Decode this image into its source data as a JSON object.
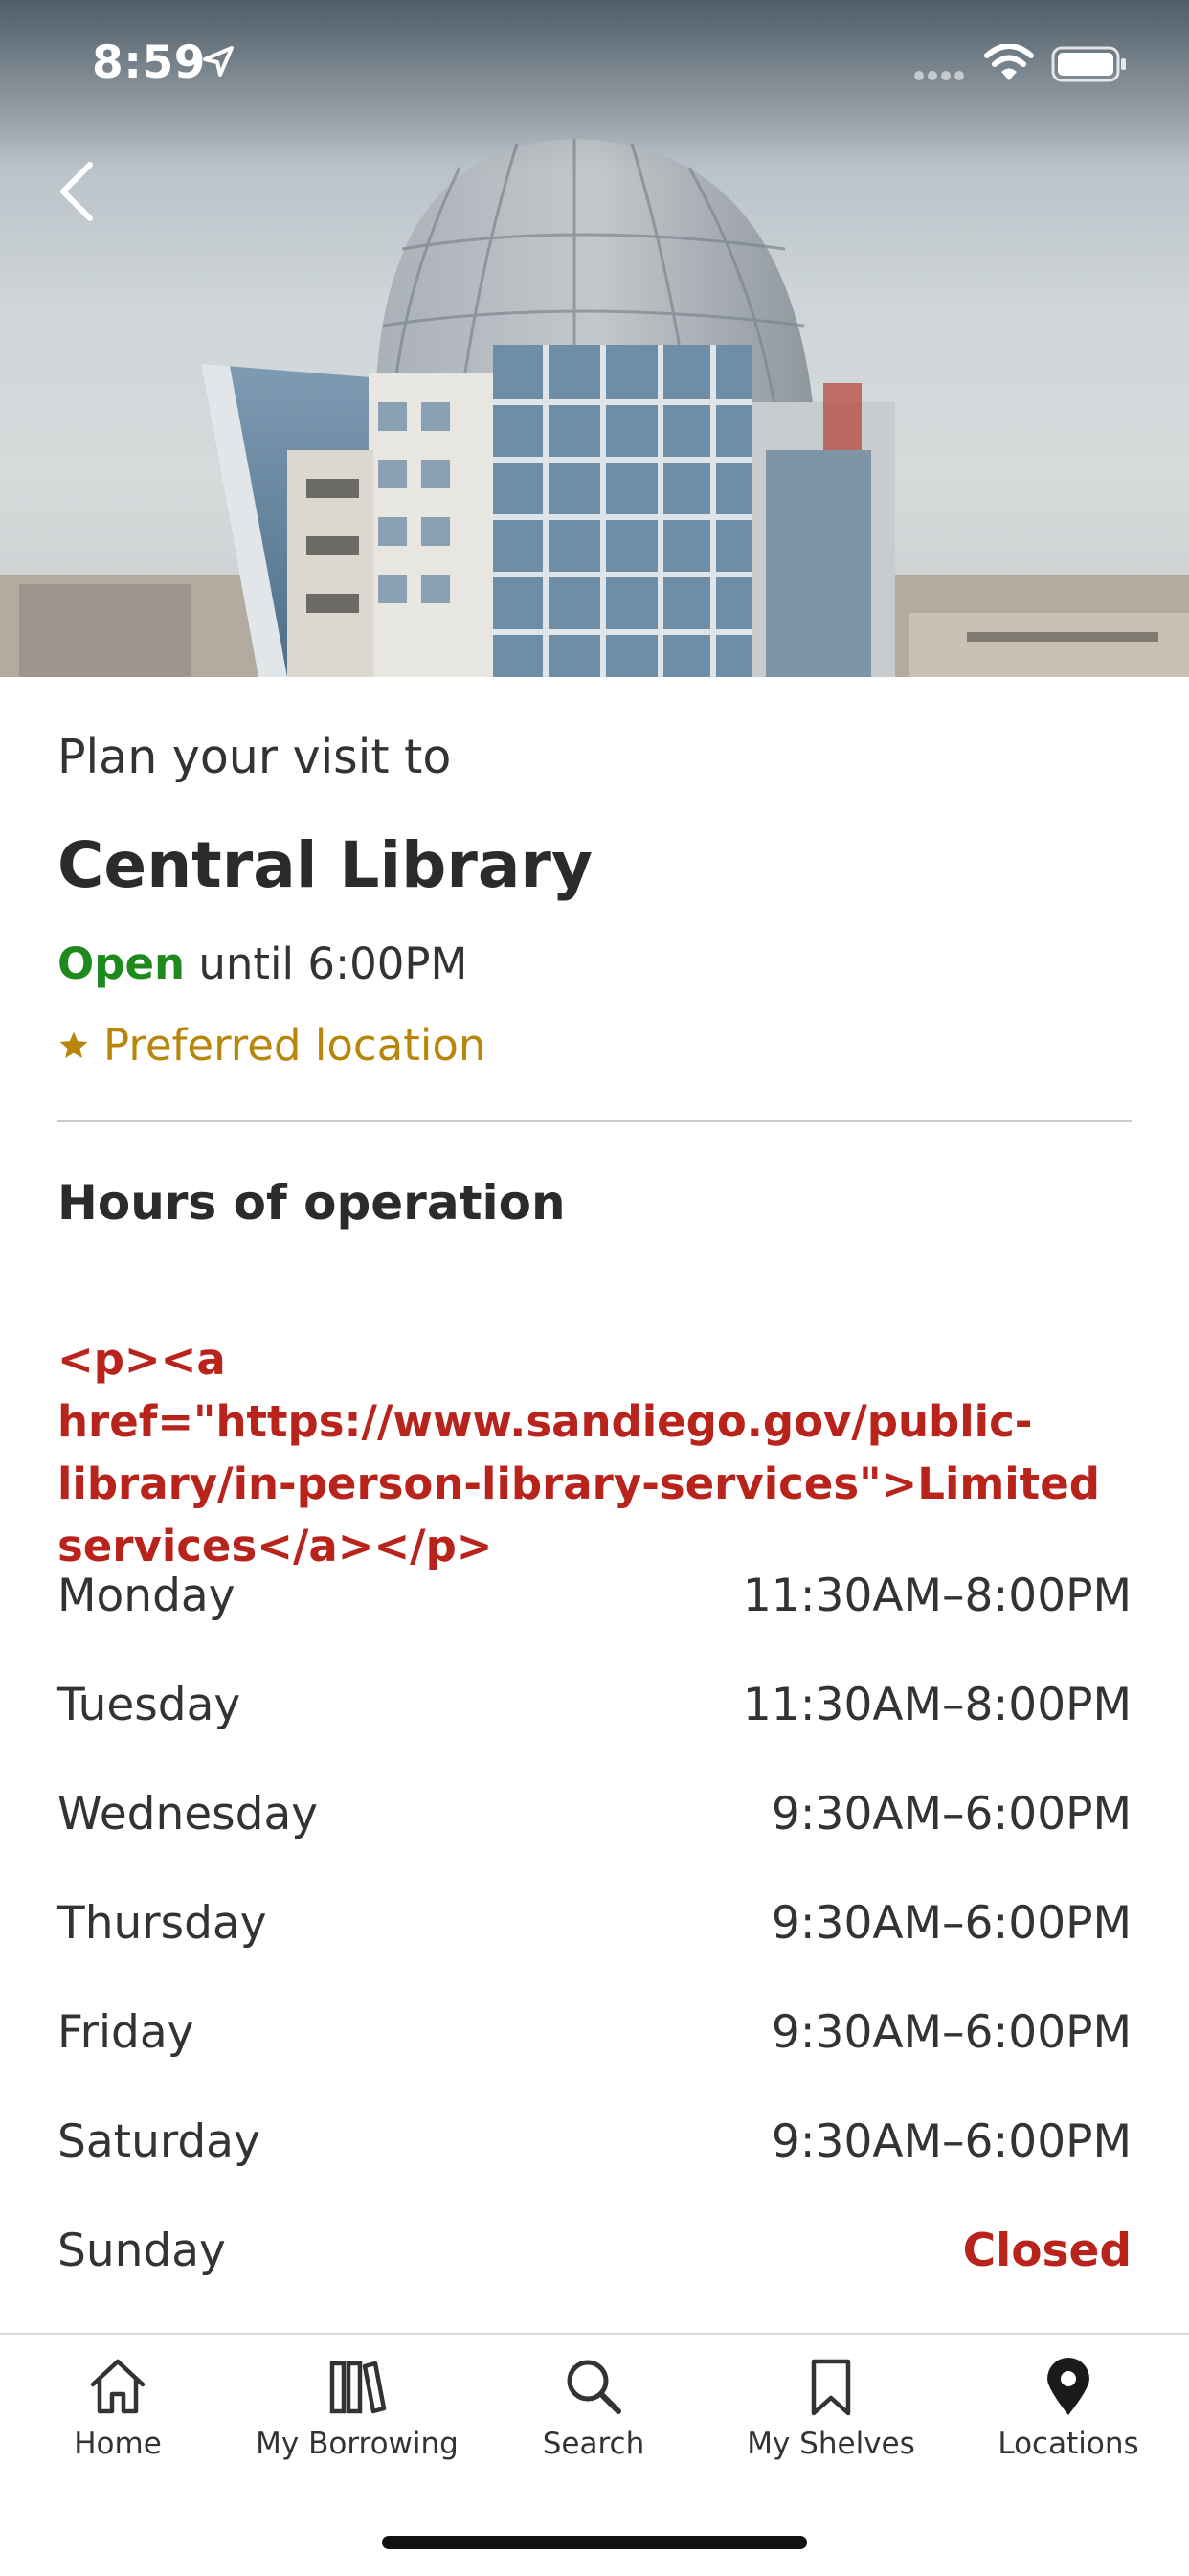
{
  "status_bar": {
    "time": "8:59"
  },
  "hero": {
    "image_subject": "Central Library building with domed roof"
  },
  "location": {
    "intro": "Plan your visit to",
    "name": "Central Library",
    "open_status": "Open",
    "open_until": "until 6:00PM",
    "preferred": "Preferred location",
    "status_color": "#1e8a1e",
    "preferred_color": "#b8860b"
  },
  "hours": {
    "heading": "Hours of operation",
    "notice": "<p><a href=\"https://www.sandiego.gov/public-library/in-person-library-services\">Limited services</a></p>",
    "days": [
      {
        "day": "Monday",
        "time": "11:30AM–8:00PM"
      },
      {
        "day": "Tuesday",
        "time": "11:30AM–8:00PM"
      },
      {
        "day": "Wednesday",
        "time": "9:30AM–6:00PM"
      },
      {
        "day": "Thursday",
        "time": "9:30AM–6:00PM"
      },
      {
        "day": "Friday",
        "time": "9:30AM–6:00PM"
      },
      {
        "day": "Saturday",
        "time": "9:30AM–6:00PM"
      },
      {
        "day": "Sunday",
        "time": "Closed"
      }
    ],
    "closed_color": "#b8231c"
  },
  "tabbar": {
    "items": [
      {
        "label": "Home",
        "icon": "home-icon"
      },
      {
        "label": "My Borrowing",
        "icon": "books-icon"
      },
      {
        "label": "Search",
        "icon": "search-icon"
      },
      {
        "label": "My Shelves",
        "icon": "bookmark-icon"
      },
      {
        "label": "Locations",
        "icon": "map-pin-icon"
      }
    ],
    "active": "Locations"
  }
}
